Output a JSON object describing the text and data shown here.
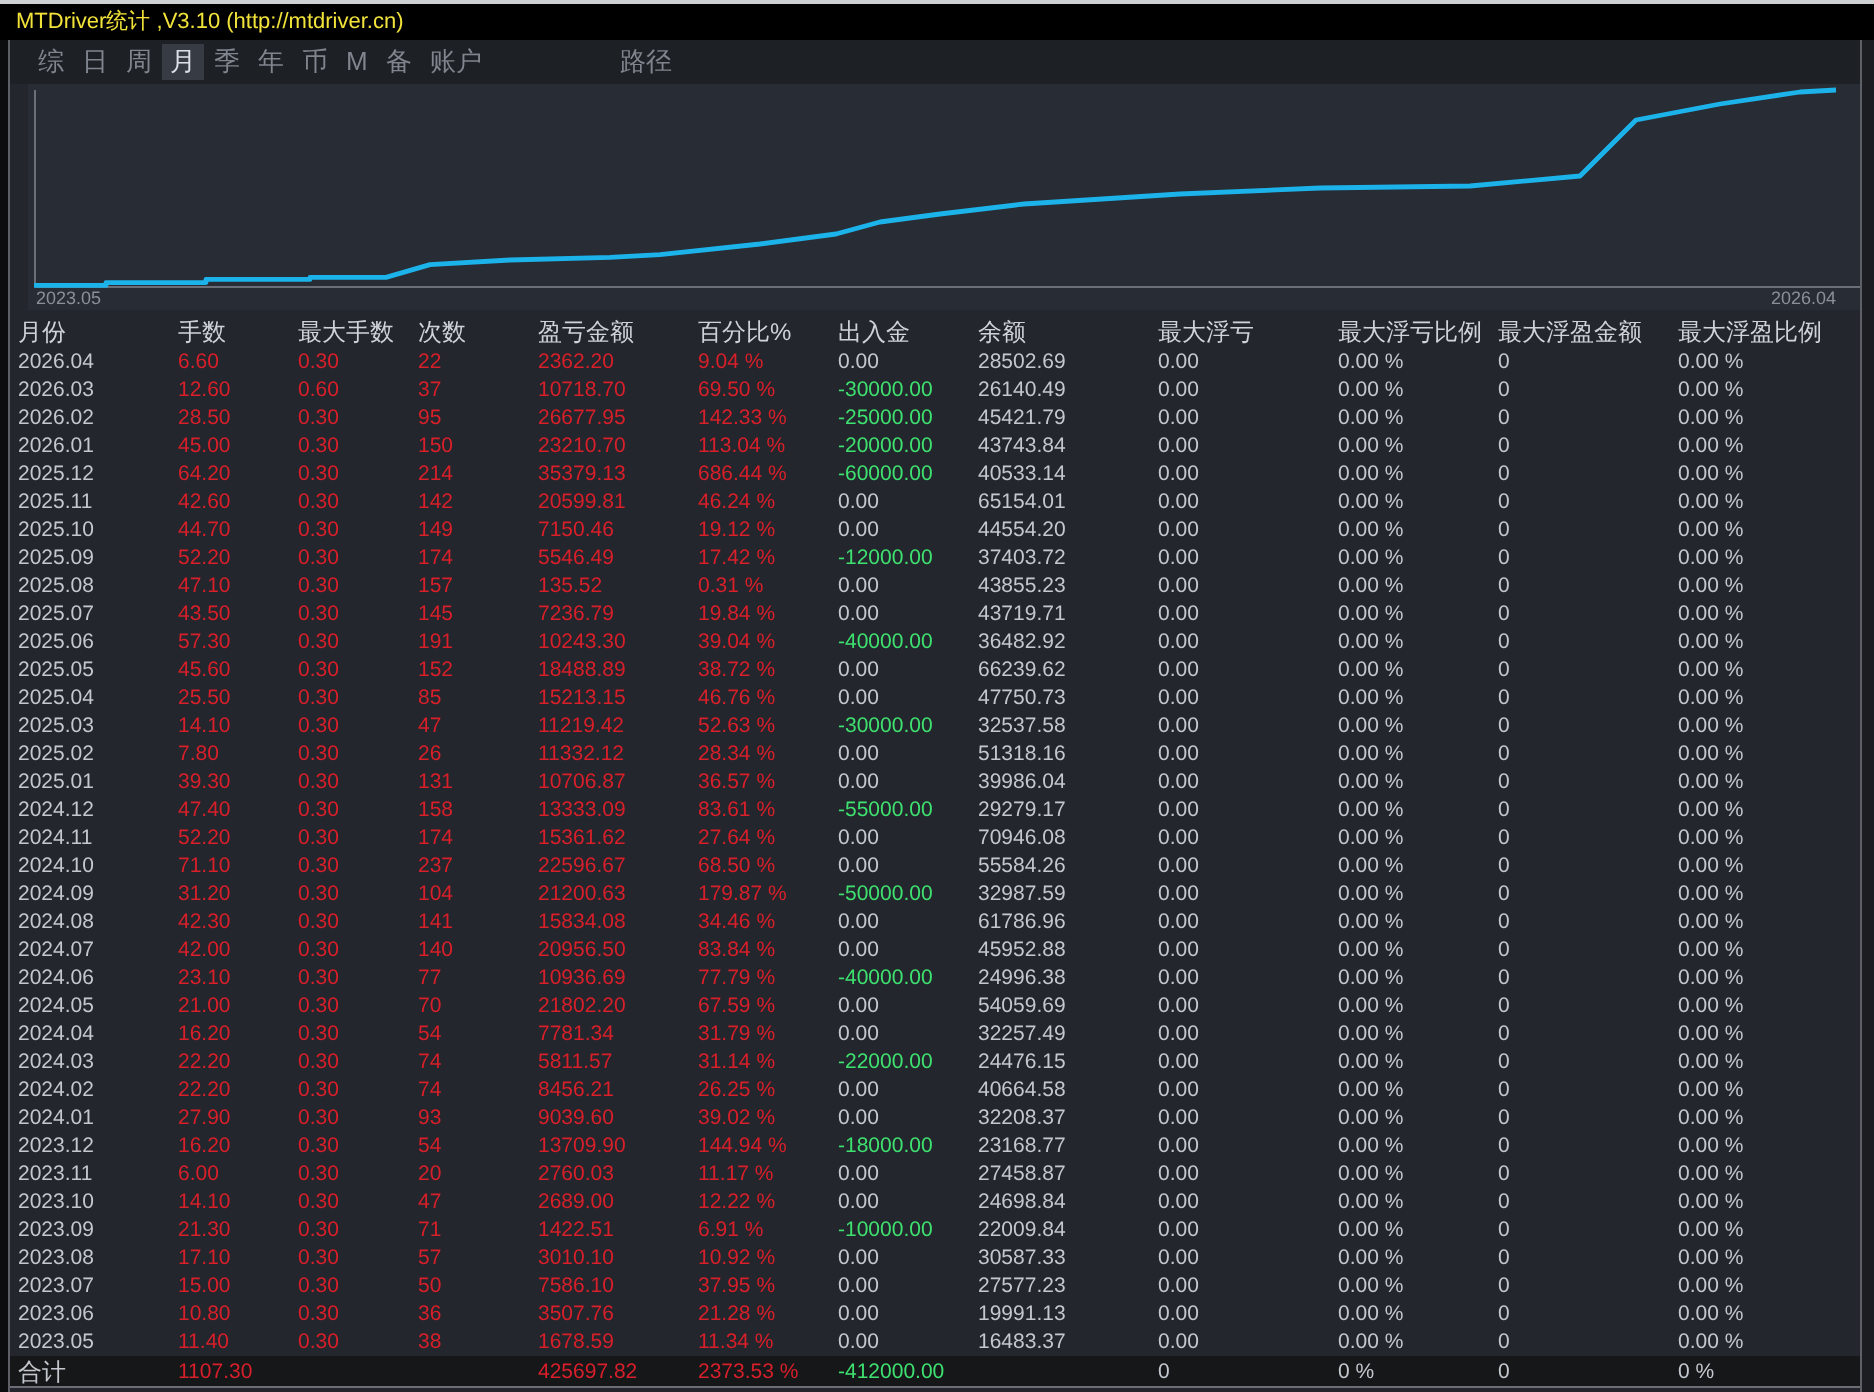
{
  "window": {
    "title": "MTDriver统计 ,V3.10 (http://mtdriver.cn)"
  },
  "tabs": [
    {
      "label": "综",
      "selected": false
    },
    {
      "label": "日",
      "selected": false
    },
    {
      "label": "周",
      "selected": false
    },
    {
      "label": "月",
      "selected": true
    },
    {
      "label": "季",
      "selected": false
    },
    {
      "label": "年",
      "selected": false
    },
    {
      "label": "币",
      "selected": false
    },
    {
      "label": "M",
      "selected": false
    },
    {
      "label": "备",
      "selected": false
    },
    {
      "label": "账户",
      "selected": false
    }
  ],
  "path_button": {
    "label": "路径"
  },
  "chart": {
    "x_start_label": "2023.05",
    "x_end_label": "2026.04"
  },
  "table": {
    "columns": [
      {
        "label": "月份",
        "kind": "plain"
      },
      {
        "label": "手数",
        "kind": "pnl"
      },
      {
        "label": "最大手数",
        "kind": "pnl"
      },
      {
        "label": "次数",
        "kind": "pnl"
      },
      {
        "label": "盈亏金额",
        "kind": "pnl"
      },
      {
        "label": "百分比%",
        "kind": "pnl"
      },
      {
        "label": "出入金",
        "kind": "flow"
      },
      {
        "label": "余额",
        "kind": "plain"
      },
      {
        "label": "最大浮亏",
        "kind": "plain"
      },
      {
        "label": "最大浮亏比例",
        "kind": "plain"
      },
      {
        "label": "最大浮盈金额",
        "kind": "plain"
      },
      {
        "label": "最大浮盈比例",
        "kind": "plain"
      }
    ],
    "rows": [
      {
        "cells": [
          "2026.04",
          "6.60",
          "0.30",
          "22",
          "2362.20",
          "9.04 %",
          "0.00",
          "28502.69",
          "0.00",
          "0.00 %",
          "0",
          "0.00 %"
        ],
        "color": "#c3c7ce"
      },
      {
        "cells": [
          "2026.03",
          "12.60",
          "0.60",
          "37",
          "10718.70",
          "69.50 %",
          "-30000.00",
          "26140.49",
          "0.00",
          "0.00 %",
          "0",
          "0.00 %"
        ],
        "color": "#3ee070"
      },
      {
        "cells": [
          "2026.02",
          "28.50",
          "0.30",
          "95",
          "26677.95",
          "142.33 %",
          "-25000.00",
          "45421.79",
          "0.00",
          "0.00 %",
          "0",
          "0.00 %"
        ],
        "color": "#3ee070"
      },
      {
        "cells": [
          "2026.01",
          "45.00",
          "0.30",
          "150",
          "23210.70",
          "113.04 %",
          "-20000.00",
          "43743.84",
          "0.00",
          "0.00 %",
          "0",
          "0.00 %"
        ],
        "color": "#3ee070"
      },
      {
        "cells": [
          "2025.12",
          "64.20",
          "0.30",
          "214",
          "35379.13",
          "686.44 %",
          "-60000.00",
          "40533.14",
          "0.00",
          "0.00 %",
          "0",
          "0.00 %"
        ],
        "color": "#3ee070"
      },
      {
        "cells": [
          "2025.11",
          "42.60",
          "0.30",
          "142",
          "20599.81",
          "46.24 %",
          "0.00",
          "65154.01",
          "0.00",
          "0.00 %",
          "0",
          "0.00 %"
        ],
        "color": "#c3c7ce"
      },
      {
        "cells": [
          "2025.10",
          "44.70",
          "0.30",
          "149",
          "7150.46",
          "19.12 %",
          "0.00",
          "44554.20",
          "0.00",
          "0.00 %",
          "0",
          "0.00 %"
        ],
        "color": "#c3c7ce"
      },
      {
        "cells": [
          "2025.09",
          "52.20",
          "0.30",
          "174",
          "5546.49",
          "17.42 %",
          "-12000.00",
          "37403.72",
          "0.00",
          "0.00 %",
          "0",
          "0.00 %"
        ],
        "color": "#3ee070"
      },
      {
        "cells": [
          "2025.08",
          "47.10",
          "0.30",
          "157",
          "135.52",
          "0.31 %",
          "0.00",
          "43855.23",
          "0.00",
          "0.00 %",
          "0",
          "0.00 %"
        ],
        "color": "#c3c7ce"
      },
      {
        "cells": [
          "2025.07",
          "43.50",
          "0.30",
          "145",
          "7236.79",
          "19.84 %",
          "0.00",
          "43719.71",
          "0.00",
          "0.00 %",
          "0",
          "0.00 %"
        ],
        "color": "#c3c7ce"
      },
      {
        "cells": [
          "2025.06",
          "57.30",
          "0.30",
          "191",
          "10243.30",
          "39.04 %",
          "-40000.00",
          "36482.92",
          "0.00",
          "0.00 %",
          "0",
          "0.00 %"
        ],
        "color": "#3ee070"
      },
      {
        "cells": [
          "2025.05",
          "45.60",
          "0.30",
          "152",
          "18488.89",
          "38.72 %",
          "0.00",
          "66239.62",
          "0.00",
          "0.00 %",
          "0",
          "0.00 %"
        ],
        "color": "#c3c7ce"
      },
      {
        "cells": [
          "2025.04",
          "25.50",
          "0.30",
          "85",
          "15213.15",
          "46.76 %",
          "0.00",
          "47750.73",
          "0.00",
          "0.00 %",
          "0",
          "0.00 %"
        ],
        "color": "#c3c7ce"
      },
      {
        "cells": [
          "2025.03",
          "14.10",
          "0.30",
          "47",
          "11219.42",
          "52.63 %",
          "-30000.00",
          "32537.58",
          "0.00",
          "0.00 %",
          "0",
          "0.00 %"
        ],
        "color": "#3ee070"
      },
      {
        "cells": [
          "2025.02",
          "7.80",
          "0.30",
          "26",
          "11332.12",
          "28.34 %",
          "0.00",
          "51318.16",
          "0.00",
          "0.00 %",
          "0",
          "0.00 %"
        ],
        "color": "#c3c7ce"
      },
      {
        "cells": [
          "2025.01",
          "39.30",
          "0.30",
          "131",
          "10706.87",
          "36.57 %",
          "0.00",
          "39986.04",
          "0.00",
          "0.00 %",
          "0",
          "0.00 %"
        ],
        "color": "#c3c7ce"
      },
      {
        "cells": [
          "2024.12",
          "47.40",
          "0.30",
          "158",
          "13333.09",
          "83.61 %",
          "-55000.00",
          "29279.17",
          "0.00",
          "0.00 %",
          "0",
          "0.00 %"
        ],
        "color": "#3ee070"
      },
      {
        "cells": [
          "2024.11",
          "52.20",
          "0.30",
          "174",
          "15361.62",
          "27.64 %",
          "0.00",
          "70946.08",
          "0.00",
          "0.00 %",
          "0",
          "0.00 %"
        ],
        "color": "#c3c7ce"
      },
      {
        "cells": [
          "2024.10",
          "71.10",
          "0.30",
          "237",
          "22596.67",
          "68.50 %",
          "0.00",
          "55584.26",
          "0.00",
          "0.00 %",
          "0",
          "0.00 %"
        ],
        "color": "#c3c7ce"
      },
      {
        "cells": [
          "2024.09",
          "31.20",
          "0.30",
          "104",
          "21200.63",
          "179.87 %",
          "-50000.00",
          "32987.59",
          "0.00",
          "0.00 %",
          "0",
          "0.00 %"
        ],
        "color": "#3ee070"
      },
      {
        "cells": [
          "2024.08",
          "42.30",
          "0.30",
          "141",
          "15834.08",
          "34.46 %",
          "0.00",
          "61786.96",
          "0.00",
          "0.00 %",
          "0",
          "0.00 %"
        ],
        "color": "#c3c7ce"
      },
      {
        "cells": [
          "2024.07",
          "42.00",
          "0.30",
          "140",
          "20956.50",
          "83.84 %",
          "0.00",
          "45952.88",
          "0.00",
          "0.00 %",
          "0",
          "0.00 %"
        ],
        "color": "#c3c7ce"
      },
      {
        "cells": [
          "2024.06",
          "23.10",
          "0.30",
          "77",
          "10936.69",
          "77.79 %",
          "-40000.00",
          "24996.38",
          "0.00",
          "0.00 %",
          "0",
          "0.00 %"
        ],
        "color": "#3ee070"
      },
      {
        "cells": [
          "2024.05",
          "21.00",
          "0.30",
          "70",
          "21802.20",
          "67.59 %",
          "0.00",
          "54059.69",
          "0.00",
          "0.00 %",
          "0",
          "0.00 %"
        ],
        "color": "#c3c7ce"
      },
      {
        "cells": [
          "2024.04",
          "16.20",
          "0.30",
          "54",
          "7781.34",
          "31.79 %",
          "0.00",
          "32257.49",
          "0.00",
          "0.00 %",
          "0",
          "0.00 %"
        ],
        "color": "#c3c7ce"
      },
      {
        "cells": [
          "2024.03",
          "22.20",
          "0.30",
          "74",
          "5811.57",
          "31.14 %",
          "-22000.00",
          "24476.15",
          "0.00",
          "0.00 %",
          "0",
          "0.00 %"
        ],
        "color": "#3ee070"
      },
      {
        "cells": [
          "2024.02",
          "22.20",
          "0.30",
          "74",
          "8456.21",
          "26.25 %",
          "0.00",
          "40664.58",
          "0.00",
          "0.00 %",
          "0",
          "0.00 %"
        ],
        "color": "#c3c7ce"
      },
      {
        "cells": [
          "2024.01",
          "27.90",
          "0.30",
          "93",
          "9039.60",
          "39.02 %",
          "0.00",
          "32208.37",
          "0.00",
          "0.00 %",
          "0",
          "0.00 %"
        ],
        "color": "#c3c7ce"
      },
      {
        "cells": [
          "2023.12",
          "16.20",
          "0.30",
          "54",
          "13709.90",
          "144.94 %",
          "-18000.00",
          "23168.77",
          "0.00",
          "0.00 %",
          "0",
          "0.00 %"
        ],
        "color": "#3ee070"
      },
      {
        "cells": [
          "2023.11",
          "6.00",
          "0.30",
          "20",
          "2760.03",
          "11.17 %",
          "0.00",
          "27458.87",
          "0.00",
          "0.00 %",
          "0",
          "0.00 %"
        ],
        "color": "#c3c7ce"
      },
      {
        "cells": [
          "2023.10",
          "14.10",
          "0.30",
          "47",
          "2689.00",
          "12.22 %",
          "0.00",
          "24698.84",
          "0.00",
          "0.00 %",
          "0",
          "0.00 %"
        ],
        "color": "#c3c7ce"
      },
      {
        "cells": [
          "2023.09",
          "21.30",
          "0.30",
          "71",
          "1422.51",
          "6.91 %",
          "-10000.00",
          "22009.84",
          "0.00",
          "0.00 %",
          "0",
          "0.00 %"
        ],
        "color": "#3ee070"
      },
      {
        "cells": [
          "2023.08",
          "17.10",
          "0.30",
          "57",
          "3010.10",
          "10.92 %",
          "0.00",
          "30587.33",
          "0.00",
          "0.00 %",
          "0",
          "0.00 %"
        ],
        "color": "#c3c7ce"
      },
      {
        "cells": [
          "2023.07",
          "15.00",
          "0.30",
          "50",
          "7586.10",
          "37.95 %",
          "0.00",
          "27577.23",
          "0.00",
          "0.00 %",
          "0",
          "0.00 %"
        ],
        "color": "#c3c7ce"
      },
      {
        "cells": [
          "2023.06",
          "10.80",
          "0.30",
          "36",
          "3507.76",
          "21.28 %",
          "0.00",
          "19991.13",
          "0.00",
          "0.00 %",
          "0",
          "0.00 %"
        ],
        "color": "#c3c7ce"
      },
      {
        "cells": [
          "2023.05",
          "11.40",
          "0.30",
          "38",
          "1678.59",
          "11.34 %",
          "0.00",
          "16483.37",
          "0.00",
          "0.00 %",
          "0",
          "0.00 %"
        ],
        "color": "#c3c7ce"
      }
    ],
    "total": {
      "cells": [
        "合计",
        "1107.30",
        null,
        null,
        "425697.82",
        "2373.53 %",
        "-412000.00",
        null,
        "0",
        "0 %",
        "0",
        "0 %"
      ],
      "color": "#3ee070"
    }
  }
}
